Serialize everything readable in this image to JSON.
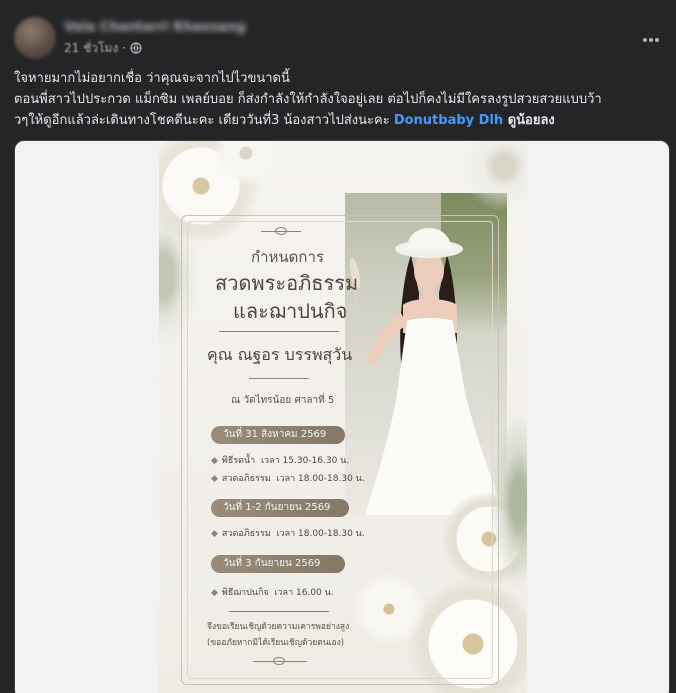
{
  "post": {
    "author_name": "Vela Chantarri Khaosang",
    "time": "21 ชั่วโมง",
    "privacy_icon": "globe-icon",
    "more_icon": "more-horizontal-icon",
    "caption": {
      "line1": "ใจหายมากไม่อยากเชื่อ ว่าคุณจะจากไปไวขนาดนี้",
      "line2": "ตอนพี่สาวไปประกวด แม็กซิม เพลย์บอย ก็ส่งกำลังให้กำลังใจอยู่เลย ต่อไปก็คงไม่มีใครลงรูปสวยสวยแบบว้า",
      "line3_prefix": "วๆให้ดูอีกแล้วล่ะเดินทางโชคดีนะคะ เดียววันที่3 น้องสาวไปส่งนะคะ ",
      "mention": "Donutbaby Dlh",
      "line3_suffix": " ดูน้อยลง"
    }
  },
  "card": {
    "heading_small": "กำหนดการ",
    "heading_line1": "สวดพระอภิธรรม",
    "heading_line2": "และฌาปนกิจ",
    "name": "คุณ ณฐอร  บรรพสุวัน",
    "venue": "ณ วัดไทรน้อย ศาลาที่ 5",
    "schedule": [
      {
        "date_label": "วันที่ 31 สิงหาคม 2569",
        "items": [
          {
            "name": "พิธีรดน้ำ",
            "time": "เวลา 15.30-16.30 น."
          },
          {
            "name": "สวดอภิธรรม",
            "time": "เวลา 18.00-18.30 น."
          }
        ]
      },
      {
        "date_label": "วันที่ 1-2 กันยายน 2569",
        "items": [
          {
            "name": "สวดอภิธรรม",
            "time": "เวลา 18.00-18.30 น."
          }
        ]
      },
      {
        "date_label": "วันที่ 3 กันยายน 2569",
        "items": [
          {
            "name": "พิธีฌาปนกิจ",
            "time": "เวลา 16.00 น."
          }
        ]
      }
    ],
    "footer_line1": "จึงขอเรียนเชิญด้วยความเคารพอย่างสูง",
    "footer_line2": "(ขออภัยหากมิได้เรียนเชิญด้วยตนเอง)"
  },
  "colors": {
    "background": "#242526",
    "text_primary": "#e4e6eb",
    "text_secondary": "#b0b3b8",
    "mention": "#4599ff",
    "card_accent": "#8b8275"
  }
}
